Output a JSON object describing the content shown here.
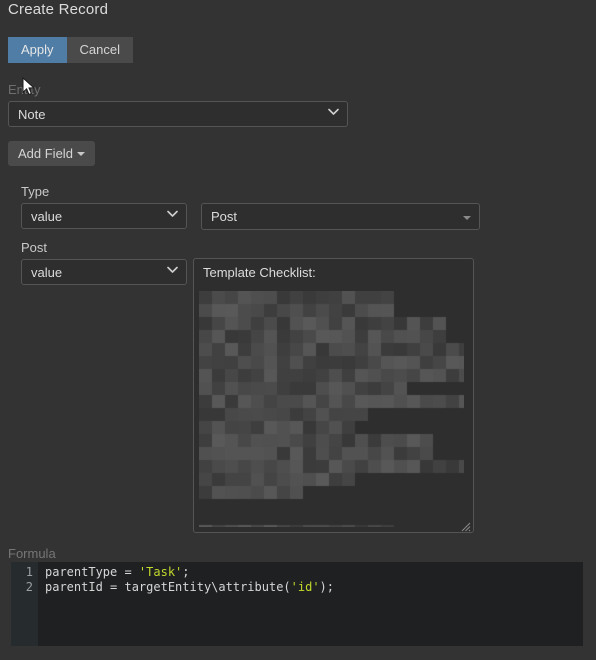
{
  "window": {
    "title": "Create Record",
    "background_color": "#333333"
  },
  "toolbar": {
    "apply_label": "Apply",
    "cancel_label": "Cancel",
    "apply_color": "#4f7da6",
    "cancel_color": "#4a4a4a"
  },
  "entity": {
    "label": "Entity",
    "value": "Note",
    "options": [
      "Note"
    ]
  },
  "add_field": {
    "label": "Add Field"
  },
  "fields": [
    {
      "label": "Type",
      "mode_value": "value",
      "mode_options": [
        "value"
      ],
      "value": "Post",
      "control": "select2"
    },
    {
      "label": "Post",
      "mode_value": "value",
      "mode_options": [
        "value"
      ],
      "value": "Template Checklist:",
      "control": "textarea"
    }
  ],
  "formula": {
    "label": "Formula",
    "lines": [
      {
        "number": "1",
        "tokens": [
          {
            "text": "parentType = ",
            "type": "plain"
          },
          {
            "text": "'Task'",
            "type": "string"
          },
          {
            "text": ";",
            "type": "plain"
          }
        ]
      },
      {
        "number": "2",
        "tokens": [
          {
            "text": "parentId = targetEntity\\attribute(",
            "type": "plain"
          },
          {
            "text": "'id'",
            "type": "string"
          },
          {
            "text": ");",
            "type": "plain"
          }
        ]
      }
    ],
    "string_color": "#c3d82c",
    "text_color": "#d6d6d6",
    "editor_bg": "#1e2022",
    "gutter_bg": "#262b2e"
  },
  "icons": {
    "chevron_down": "⌄",
    "caret_down": "caret-down-icon",
    "cursor": "mouse-pointer-icon",
    "resize_grip": "resize-grip-icon"
  }
}
